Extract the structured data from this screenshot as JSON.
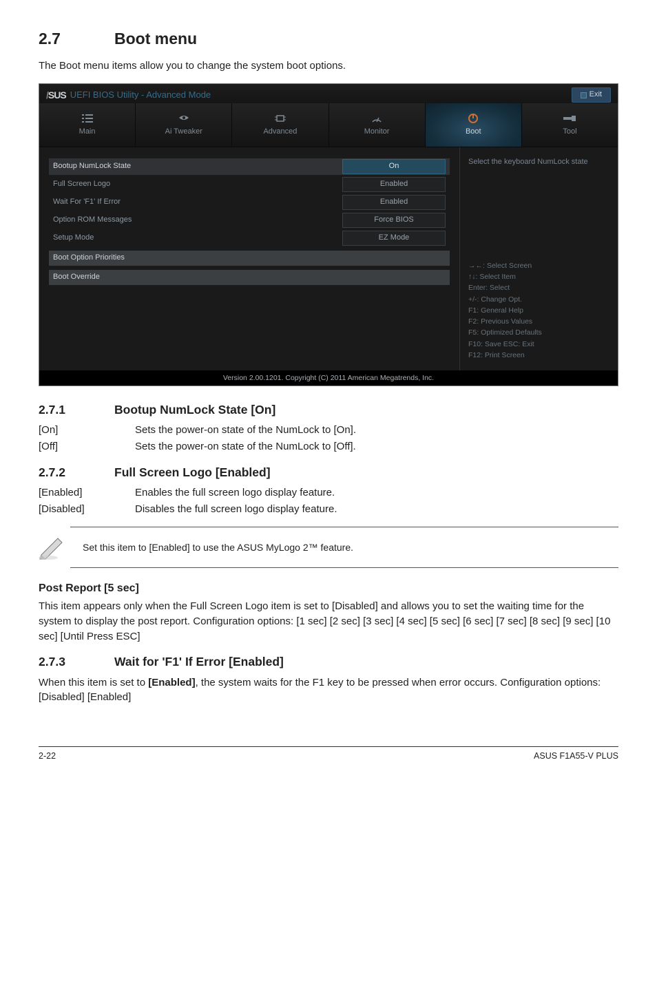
{
  "section": {
    "number": "2.7",
    "title": "Boot menu"
  },
  "intro": "The Boot menu items allow you to change the system boot options.",
  "bios": {
    "brand_pre": "/",
    "brand": "SUS",
    "title": "UEFI BIOS Utility - Advanced Mode",
    "exit": "Exit",
    "tabs": [
      "Main",
      "Ai  Tweaker",
      "Advanced",
      "Monitor",
      "Boot",
      "Tool"
    ],
    "active_tab": 4,
    "rows": [
      {
        "label": "Bootup NumLock State",
        "value": "On",
        "hl": true,
        "on": true
      },
      {
        "label": "Full Screen Logo",
        "value": "Enabled"
      },
      {
        "label": "Wait For 'F1' If Error",
        "value": "Enabled"
      },
      {
        "label": "Option ROM Messages",
        "value": "Force BIOS"
      },
      {
        "label": "Setup Mode",
        "value": "EZ Mode"
      }
    ],
    "groups": [
      "Boot Option Priorities",
      "Boot Override"
    ],
    "help": "Select the keyboard NumLock state",
    "keys": [
      "→←:  Select Screen",
      "↑↓:  Select Item",
      "Enter:  Select",
      "+/-:  Change Opt.",
      "F1:  General Help",
      "F2:  Previous Values",
      "F5:  Optimized Defaults",
      "F10:  Save   ESC:  Exit",
      "F12:  Print Screen"
    ],
    "footer": "Version  2.00.1201.   Copyright  (C)  2011 American  Megatrends,  Inc."
  },
  "s271": {
    "num": "2.7.1",
    "title": "Bootup NumLock State [On]",
    "opts": [
      {
        "k": "[On]",
        "v": "Sets the power-on state of the NumLock to [On]."
      },
      {
        "k": "[Off]",
        "v": "Sets the power-on state of the NumLock to [Off]."
      }
    ]
  },
  "s272": {
    "num": "2.7.2",
    "title": "Full Screen Logo [Enabled]",
    "opts": [
      {
        "k": "[Enabled]",
        "v": "Enables the full screen logo display feature."
      },
      {
        "k": "[Disabled]",
        "v": "Disables the full screen logo display feature."
      }
    ]
  },
  "note": "Set this item to [Enabled] to use the ASUS MyLogo 2™ feature.",
  "post": {
    "head": "Post Report [5 sec]",
    "body": "This item appears only when the Full Screen Logo item is set to [Disabled] and allows you to set the waiting time for the system to display the post report. Configuration options: [1 sec] [2 sec] [3 sec] [4 sec] [5 sec] [6 sec] [7 sec] [8 sec] [9 sec] [10 sec] [Until Press ESC]"
  },
  "s273": {
    "num": "2.7.3",
    "title": "Wait for 'F1' If Error [Enabled]",
    "body_pre": "When this item is set to ",
    "body_bold": "[Enabled]",
    "body_post": ", the system waits for the F1 key to be pressed when error occurs. Configuration options: [Disabled] [Enabled]"
  },
  "pagefoot": {
    "left": "2-22",
    "right": "ASUS F1A55-V PLUS"
  }
}
